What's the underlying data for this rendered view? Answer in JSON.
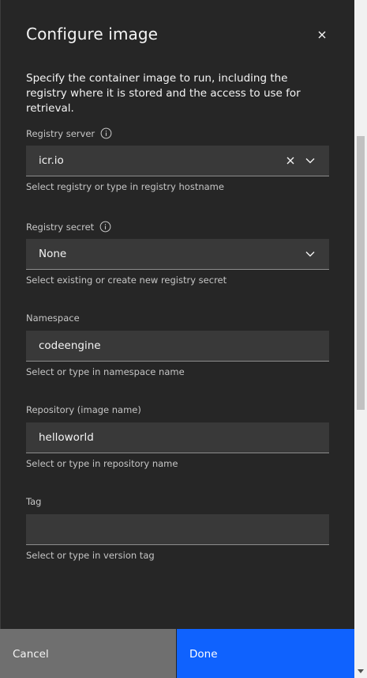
{
  "header": {
    "title": "Configure image",
    "description": "Specify the container image to run, including the registry where it is stored and the access to use for retrieval."
  },
  "fields": {
    "registry_server": {
      "label": "Registry server",
      "value": "icr.io",
      "helper": "Select registry or type in registry hostname"
    },
    "registry_secret": {
      "label": "Registry secret",
      "value": "None",
      "helper": "Select existing or create new registry secret"
    },
    "namespace": {
      "label": "Namespace",
      "value": "codeengine",
      "helper": "Select or type in namespace name"
    },
    "repository": {
      "label": "Repository (image name)",
      "value": "helloworld",
      "helper": "Select or type in repository name"
    },
    "tag": {
      "label": "Tag",
      "value": "",
      "helper": "Select or type in version tag"
    }
  },
  "footer": {
    "cancel_label": "Cancel",
    "done_label": "Done"
  },
  "colors": {
    "primary": "#0f62fe",
    "secondary_button": "#6f6f6f",
    "panel_bg": "#262626",
    "field_bg": "#393939"
  },
  "icons": {
    "close": "close-icon",
    "info": "info-icon",
    "clear": "clear-icon",
    "dropdown": "chevron-down-icon"
  }
}
